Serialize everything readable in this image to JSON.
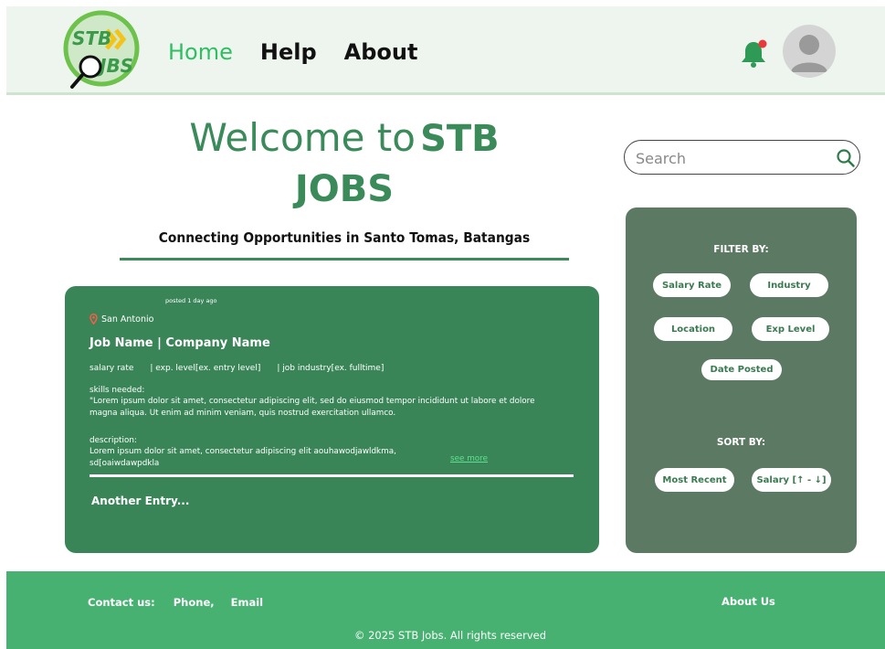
{
  "header": {
    "nav": [
      {
        "label": "Home",
        "active": true
      },
      {
        "label": "Help",
        "active": false
      },
      {
        "label": "About",
        "active": false
      }
    ]
  },
  "hero": {
    "welcome_prefix": "Welcome to",
    "brand_1": "STB",
    "brand_2": "JOBS",
    "tagline": "Connecting Opportunities in Santo Tomas, Batangas"
  },
  "search": {
    "placeholder": "Search"
  },
  "job": {
    "posted": "posted 1 day ago",
    "location": "San Antonio",
    "title": "Job Name  | Company Name",
    "salary": "salary rate",
    "exp": "| exp. level[ex. entry level]",
    "industry": "| job industry[ex. fulltime]",
    "skills_label": "skills needed:",
    "skills_text": "\"Lorem ipsum dolor sit amet, consectetur adipiscing elit, sed do eiusmod tempor incididunt ut labore et dolore magna aliqua. Ut enim ad minim veniam, quis nostrud exercitation ullamco.",
    "description_label": "description:",
    "description_text": "Lorem ipsum dolor sit amet, consectetur adipiscing elit aouhawodjawldkma, sd[oaiwdawpdkla",
    "see_more": "see more",
    "another": "Another Entry..."
  },
  "filters": {
    "filter_title": "FILTER BY:",
    "salary_rate": "Salary Rate",
    "industry": "Industry",
    "location": "Location",
    "exp_level": "Exp Level",
    "date_posted": "Date Posted",
    "sort_title": "SORT BY:",
    "most_recent": "Most Recent",
    "salary_sort": "Salary [↑ - ↓]"
  },
  "footer": {
    "contact_label": "Contact us:",
    "phone": "Phone,",
    "email": "Email",
    "about_us": "About Us",
    "copyright": "© 2025 STB Jobs. All rights reserved"
  },
  "colors": {
    "primary_green": "#3a8558",
    "footer_green": "#47b171",
    "active_nav": "#2fbf62",
    "panel": "#5c7a63"
  },
  "icons": {
    "logo": "stb-jobs-logo-magnifier",
    "bell": "notification-bell-icon",
    "avatar": "user-avatar-icon",
    "search": "search-icon",
    "location": "map-pin-icon"
  }
}
